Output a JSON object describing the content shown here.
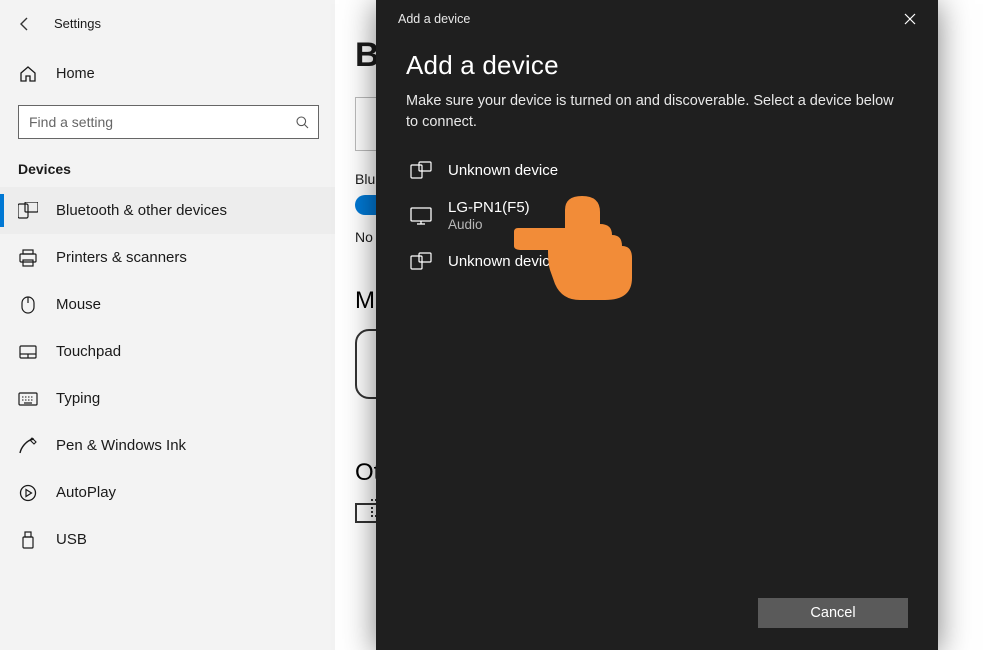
{
  "settings": {
    "title": "Settings",
    "home": "Home",
    "search_placeholder": "Find a setting",
    "category": "Devices",
    "nav": [
      {
        "label": "Bluetooth & other devices",
        "icon": "bluetooth-devices-icon",
        "active": true
      },
      {
        "label": "Printers & scanners",
        "icon": "printer-icon",
        "active": false
      },
      {
        "label": "Mouse",
        "icon": "mouse-icon",
        "active": false
      },
      {
        "label": "Touchpad",
        "icon": "touchpad-icon",
        "active": false
      },
      {
        "label": "Typing",
        "icon": "keyboard-icon",
        "active": false
      },
      {
        "label": "Pen & Windows Ink",
        "icon": "pen-icon",
        "active": false
      },
      {
        "label": "AutoPlay",
        "icon": "autoplay-icon",
        "active": false
      },
      {
        "label": "USB",
        "icon": "usb-icon",
        "active": false
      }
    ]
  },
  "main": {
    "heading_clip": "Bl",
    "bluetooth_label_clip": "Blu",
    "now_label_clip": "No",
    "section2_clip": "Mo",
    "section3_clip": "Ot"
  },
  "dialog": {
    "titlebar": "Add a device",
    "heading": "Add a device",
    "sub": "Make sure your device is turned on and discoverable. Select a device below to connect.",
    "devices": [
      {
        "name": "Unknown device",
        "sub": "",
        "icon": "device-generic-icon"
      },
      {
        "name": "LG-PN1(F5)",
        "sub": "Audio",
        "icon": "monitor-icon"
      },
      {
        "name": "Unknown device",
        "sub": "",
        "icon": "device-generic-icon"
      }
    ],
    "cancel": "Cancel"
  },
  "colors": {
    "accent": "#0078d4",
    "dialog_bg": "#1f1f1f",
    "hand": "#f28c38"
  }
}
